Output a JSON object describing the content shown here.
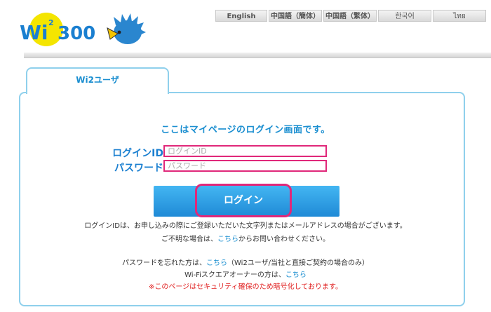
{
  "languages": [
    "English",
    "中国語（簡体）",
    "中国語（繁体）",
    "한국어",
    "ไทย"
  ],
  "logo": {
    "text": "Wi2 300"
  },
  "tab": {
    "label": "Wi2ユーザ"
  },
  "login": {
    "heading": "ここはマイページのログイン画面です。",
    "id_label": "ログインID",
    "id_placeholder": "ログインID",
    "password_label": "パスワード",
    "password_placeholder": "パスワード",
    "button_label": "ログイン"
  },
  "notes": {
    "id_note": "ログインIDは、お申し込みの際にご登録いただいた文字列またはメールアドレスの場合がございます。",
    "unknown_prefix": "ご不明な場合は、",
    "unknown_link": "こちら",
    "unknown_suffix": "からお問い合わせください。",
    "forgot_prefix": "パスワードを忘れた方は、",
    "forgot_link": "こちら",
    "forgot_suffix": "（Wi2ユーザ/当社と直接ご契約の場合のみ）",
    "owner_prefix": "Wi-Fiスクエアオーナーの方は、",
    "owner_link": "こちら",
    "security_note": "※このページはセキュリティ確保のため暗号化しております。"
  },
  "colors": {
    "accent": "#1a8ed0",
    "highlight": "#e0287a",
    "warning": "#e02020"
  }
}
